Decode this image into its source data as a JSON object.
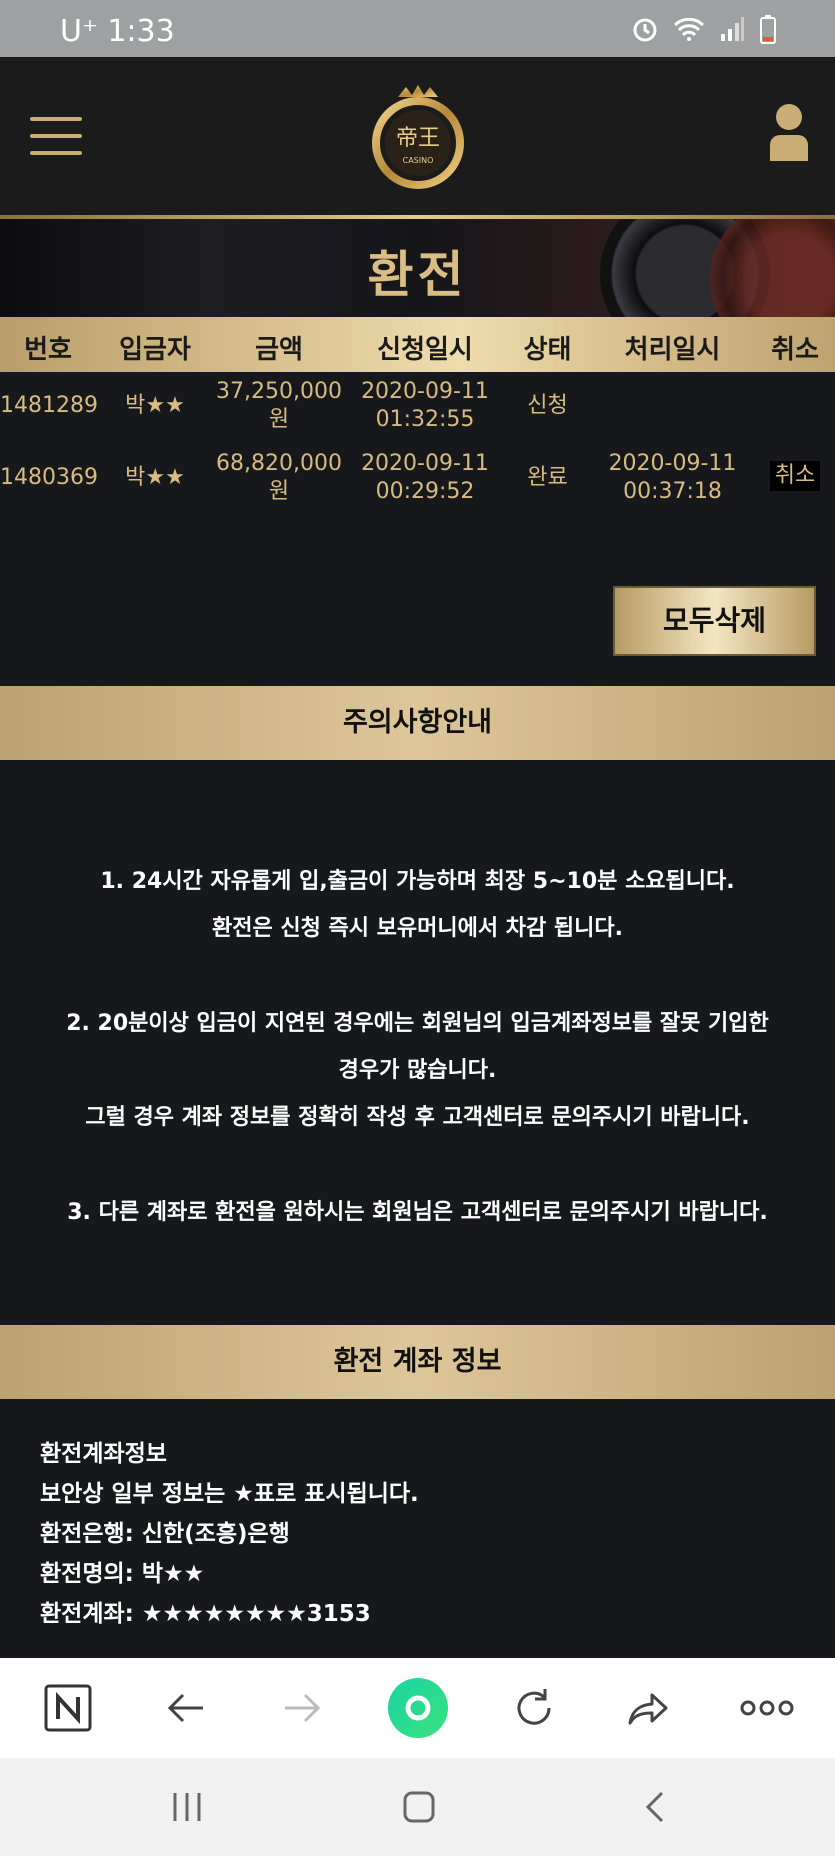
{
  "status": {
    "carrier_time": "U⁺ 1:33"
  },
  "header": {
    "logo_text": "帝王",
    "logo_sub": "CASINO"
  },
  "banner": {
    "title": "환전"
  },
  "table": {
    "headers": [
      "번호",
      "입금자",
      "금액",
      "신청일시",
      "상태",
      "처리일시",
      "취소"
    ],
    "rows": [
      {
        "no": "1481289",
        "depositor": "박★★",
        "amount_1": "37,250,000",
        "amount_2": "원",
        "req_date": "2020-09-11",
        "req_time": "01:32:55",
        "status": "신청",
        "proc_date": "",
        "proc_time": "",
        "cancel": ""
      },
      {
        "no": "1480369",
        "depositor": "박★★",
        "amount_1": "68,820,000",
        "amount_2": "원",
        "req_date": "2020-09-11",
        "req_time": "00:29:52",
        "status": "완료",
        "proc_date": "2020-09-11",
        "proc_time": "00:37:18",
        "cancel": "취소"
      }
    ]
  },
  "delete_all_label": "모두삭제",
  "notice": {
    "title": "주의사항안내",
    "lines": [
      "1. 24시간 자유롭게 입,출금이 가능하며 최장 5~10분 소요됩니다.",
      "환전은 신청 즉시 보유머니에서 차감 됩니다.",
      "2. 20분이상 입금이 지연된 경우에는 회원님의 입금계좌정보를 잘못 기입한",
      "경우가 많습니다.",
      "그럴 경우 계좌 정보를 정확히 작성 후 고객센터로 문의주시기 바랍니다.",
      "3. 다른 계좌로 환전을 원하시는 회원님은 고객센터로 문의주시기 바랍니다."
    ]
  },
  "account": {
    "title": "환전 계좌 정보",
    "lines": [
      "환전계좌정보",
      "보안상 일부 정보는 ★표로 표시됩니다.",
      "환전은행: 신한(조흥)은행",
      "환전명의: 박★★",
      "환전계좌: ★★★★★★★★3153"
    ]
  },
  "colors": {
    "gold": "#d7bb80",
    "dark_bg": "#17181c"
  }
}
